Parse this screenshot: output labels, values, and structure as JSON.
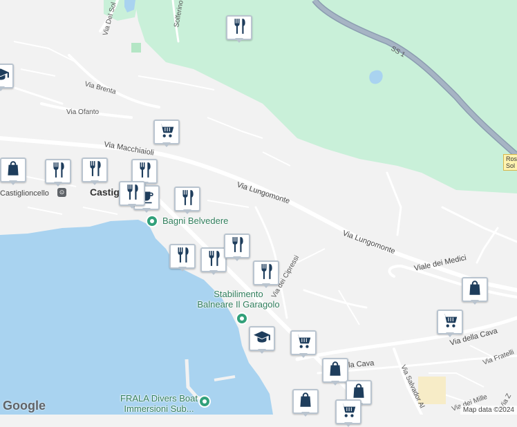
{
  "map": {
    "streets": {
      "via_del_sol": "Via Del Sol",
      "solferino": "Solferino",
      "ss1": "SS 1",
      "via_brenta": "Via Brenta",
      "via_ofanto": "Via Ofanto",
      "via_macchiaioli": "Via Macchiaioli",
      "via_lungomonte_1": "Via Lungomonte",
      "via_lungomonte_2": "Via Lungomonte",
      "viale_dei_medici": "Viale dei Medici",
      "via_dei_cipressi": "Via dei Cipressi",
      "via_della_cava_1": "Via della Cava",
      "via_della_cava_2": "lla Cava",
      "via_salvador": "Via Salvador Al",
      "via_fratelli": "Via Fratelli",
      "via_mille": "Via dei Mille",
      "via_z": "Via Z"
    },
    "places": {
      "castiglioncello_station": "Castiglioncello",
      "castiglioncello_town": "Castig",
      "shield_text_1": "Rosi",
      "shield_text_2": "Sol"
    },
    "pois": {
      "bagni_belvedere": "Bagni Belvedere",
      "stabilimento_line1": "Stabilimento",
      "stabilimento_line2": "Balneare Il Garagolo",
      "frala_line1": "FRALA Divers Boat",
      "frala_line2": "Immersioni Sub..."
    },
    "colors": {
      "water": "#a9d3f0",
      "park": "#c9f0d9",
      "land": "#f2f2f2",
      "road": "#ffffff",
      "highway": "#8b9cb0",
      "marker_icon": "#1e3d5c",
      "marker_border": "#b9c4cf",
      "poi_green": "#2f7d5b"
    },
    "markers": [
      {
        "icon": "restaurant-icon"
      },
      {
        "icon": "shopping-cart-icon"
      },
      {
        "icon": "graduation-cap-icon"
      },
      {
        "icon": "shopping-bag-icon"
      },
      {
        "icon": "restaurant-icon"
      },
      {
        "icon": "restaurant-icon"
      },
      {
        "icon": "restaurant-icon"
      },
      {
        "icon": "coffee-icon"
      },
      {
        "icon": "restaurant-icon"
      },
      {
        "icon": "restaurant-icon"
      },
      {
        "icon": "restaurant-icon"
      },
      {
        "icon": "restaurant-icon"
      },
      {
        "icon": "restaurant-icon"
      },
      {
        "icon": "graduation-cap-icon"
      },
      {
        "icon": "shopping-cart-icon"
      },
      {
        "icon": "restaurant-icon"
      },
      {
        "icon": "shopping-bag-icon"
      },
      {
        "icon": "shopping-bag-icon"
      },
      {
        "icon": "shopping-bag-icon"
      },
      {
        "icon": "shopping-cart-icon"
      },
      {
        "icon": "shopping-bag-icon"
      },
      {
        "icon": "shopping-cart-icon"
      }
    ]
  },
  "footer": {
    "logo": "Google",
    "attribution": "Map data ©2024"
  }
}
